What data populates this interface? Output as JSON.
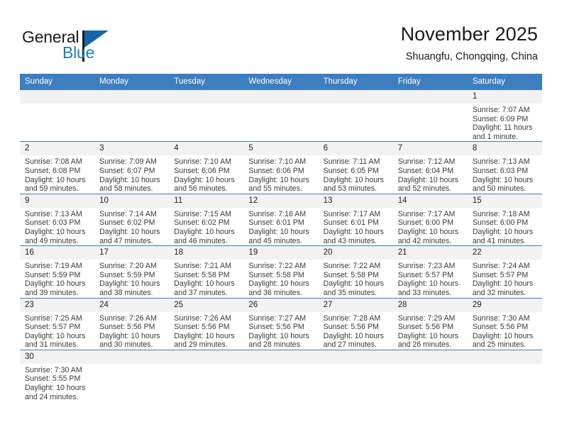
{
  "brand": {
    "name_top": "General",
    "name_bottom": "Blue",
    "triangle_color": "#1565a8",
    "blue_text_color": "#1f7ac0"
  },
  "header": {
    "title": "November 2025",
    "subtitle": "Shuangfu, Chongqing, China"
  },
  "theme": {
    "header_row_bg": "#3c7ebf",
    "daynum_bg": "#f2f2f2",
    "row_divider": "#3c7ebf",
    "text": "#3a3a3a"
  },
  "weekdays": [
    "Sunday",
    "Monday",
    "Tuesday",
    "Wednesday",
    "Thursday",
    "Friday",
    "Saturday"
  ],
  "weeks": [
    [
      {
        "empty": true,
        "day": ""
      },
      {
        "empty": true,
        "day": ""
      },
      {
        "empty": true,
        "day": ""
      },
      {
        "empty": true,
        "day": ""
      },
      {
        "empty": true,
        "day": ""
      },
      {
        "empty": true,
        "day": ""
      },
      {
        "empty": false,
        "day": "1",
        "sunrise": "Sunrise: 7:07 AM",
        "sunset": "Sunset: 6:09 PM",
        "daylight": "Daylight: 11 hours and 1 minute."
      }
    ],
    [
      {
        "empty": false,
        "day": "2",
        "sunrise": "Sunrise: 7:08 AM",
        "sunset": "Sunset: 6:08 PM",
        "daylight": "Daylight: 10 hours and 59 minutes."
      },
      {
        "empty": false,
        "day": "3",
        "sunrise": "Sunrise: 7:09 AM",
        "sunset": "Sunset: 6:07 PM",
        "daylight": "Daylight: 10 hours and 58 minutes."
      },
      {
        "empty": false,
        "day": "4",
        "sunrise": "Sunrise: 7:10 AM",
        "sunset": "Sunset: 6:06 PM",
        "daylight": "Daylight: 10 hours and 56 minutes."
      },
      {
        "empty": false,
        "day": "5",
        "sunrise": "Sunrise: 7:10 AM",
        "sunset": "Sunset: 6:06 PM",
        "daylight": "Daylight: 10 hours and 55 minutes."
      },
      {
        "empty": false,
        "day": "6",
        "sunrise": "Sunrise: 7:11 AM",
        "sunset": "Sunset: 6:05 PM",
        "daylight": "Daylight: 10 hours and 53 minutes."
      },
      {
        "empty": false,
        "day": "7",
        "sunrise": "Sunrise: 7:12 AM",
        "sunset": "Sunset: 6:04 PM",
        "daylight": "Daylight: 10 hours and 52 minutes."
      },
      {
        "empty": false,
        "day": "8",
        "sunrise": "Sunrise: 7:13 AM",
        "sunset": "Sunset: 6:03 PM",
        "daylight": "Daylight: 10 hours and 50 minutes."
      }
    ],
    [
      {
        "empty": false,
        "day": "9",
        "sunrise": "Sunrise: 7:13 AM",
        "sunset": "Sunset: 6:03 PM",
        "daylight": "Daylight: 10 hours and 49 minutes."
      },
      {
        "empty": false,
        "day": "10",
        "sunrise": "Sunrise: 7:14 AM",
        "sunset": "Sunset: 6:02 PM",
        "daylight": "Daylight: 10 hours and 47 minutes."
      },
      {
        "empty": false,
        "day": "11",
        "sunrise": "Sunrise: 7:15 AM",
        "sunset": "Sunset: 6:02 PM",
        "daylight": "Daylight: 10 hours and 46 minutes."
      },
      {
        "empty": false,
        "day": "12",
        "sunrise": "Sunrise: 7:16 AM",
        "sunset": "Sunset: 6:01 PM",
        "daylight": "Daylight: 10 hours and 45 minutes."
      },
      {
        "empty": false,
        "day": "13",
        "sunrise": "Sunrise: 7:17 AM",
        "sunset": "Sunset: 6:01 PM",
        "daylight": "Daylight: 10 hours and 43 minutes."
      },
      {
        "empty": false,
        "day": "14",
        "sunrise": "Sunrise: 7:17 AM",
        "sunset": "Sunset: 6:00 PM",
        "daylight": "Daylight: 10 hours and 42 minutes."
      },
      {
        "empty": false,
        "day": "15",
        "sunrise": "Sunrise: 7:18 AM",
        "sunset": "Sunset: 6:00 PM",
        "daylight": "Daylight: 10 hours and 41 minutes."
      }
    ],
    [
      {
        "empty": false,
        "day": "16",
        "sunrise": "Sunrise: 7:19 AM",
        "sunset": "Sunset: 5:59 PM",
        "daylight": "Daylight: 10 hours and 39 minutes."
      },
      {
        "empty": false,
        "day": "17",
        "sunrise": "Sunrise: 7:20 AM",
        "sunset": "Sunset: 5:59 PM",
        "daylight": "Daylight: 10 hours and 38 minutes."
      },
      {
        "empty": false,
        "day": "18",
        "sunrise": "Sunrise: 7:21 AM",
        "sunset": "Sunset: 5:58 PM",
        "daylight": "Daylight: 10 hours and 37 minutes."
      },
      {
        "empty": false,
        "day": "19",
        "sunrise": "Sunrise: 7:22 AM",
        "sunset": "Sunset: 5:58 PM",
        "daylight": "Daylight: 10 hours and 36 minutes."
      },
      {
        "empty": false,
        "day": "20",
        "sunrise": "Sunrise: 7:22 AM",
        "sunset": "Sunset: 5:58 PM",
        "daylight": "Daylight: 10 hours and 35 minutes."
      },
      {
        "empty": false,
        "day": "21",
        "sunrise": "Sunrise: 7:23 AM",
        "sunset": "Sunset: 5:57 PM",
        "daylight": "Daylight: 10 hours and 33 minutes."
      },
      {
        "empty": false,
        "day": "22",
        "sunrise": "Sunrise: 7:24 AM",
        "sunset": "Sunset: 5:57 PM",
        "daylight": "Daylight: 10 hours and 32 minutes."
      }
    ],
    [
      {
        "empty": false,
        "day": "23",
        "sunrise": "Sunrise: 7:25 AM",
        "sunset": "Sunset: 5:57 PM",
        "daylight": "Daylight: 10 hours and 31 minutes."
      },
      {
        "empty": false,
        "day": "24",
        "sunrise": "Sunrise: 7:26 AM",
        "sunset": "Sunset: 5:56 PM",
        "daylight": "Daylight: 10 hours and 30 minutes."
      },
      {
        "empty": false,
        "day": "25",
        "sunrise": "Sunrise: 7:26 AM",
        "sunset": "Sunset: 5:56 PM",
        "daylight": "Daylight: 10 hours and 29 minutes."
      },
      {
        "empty": false,
        "day": "26",
        "sunrise": "Sunrise: 7:27 AM",
        "sunset": "Sunset: 5:56 PM",
        "daylight": "Daylight: 10 hours and 28 minutes."
      },
      {
        "empty": false,
        "day": "27",
        "sunrise": "Sunrise: 7:28 AM",
        "sunset": "Sunset: 5:56 PM",
        "daylight": "Daylight: 10 hours and 27 minutes."
      },
      {
        "empty": false,
        "day": "28",
        "sunrise": "Sunrise: 7:29 AM",
        "sunset": "Sunset: 5:56 PM",
        "daylight": "Daylight: 10 hours and 26 minutes."
      },
      {
        "empty": false,
        "day": "29",
        "sunrise": "Sunrise: 7:30 AM",
        "sunset": "Sunset: 5:56 PM",
        "daylight": "Daylight: 10 hours and 25 minutes."
      }
    ],
    [
      {
        "empty": false,
        "day": "30",
        "sunrise": "Sunrise: 7:30 AM",
        "sunset": "Sunset: 5:55 PM",
        "daylight": "Daylight: 10 hours and 24 minutes."
      },
      {
        "empty": true,
        "day": ""
      },
      {
        "empty": true,
        "day": ""
      },
      {
        "empty": true,
        "day": ""
      },
      {
        "empty": true,
        "day": ""
      },
      {
        "empty": true,
        "day": ""
      },
      {
        "empty": true,
        "day": ""
      }
    ]
  ]
}
